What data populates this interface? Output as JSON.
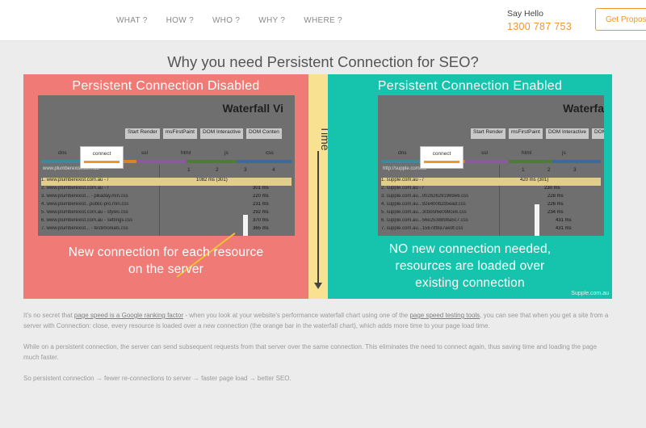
{
  "header": {
    "nav": [
      "WHAT ?",
      "HOW ?",
      "WHO ?",
      "WHY ?",
      "WHERE ?"
    ],
    "say_hello": "Say Hello",
    "phone": "1300 787 753",
    "cta": "Get Proposal"
  },
  "title": "Why you need Persistent Connection for SEO?",
  "infographic": {
    "left_heading": "Persistent Connection Disabled",
    "right_heading": "Persistent Connection Enabled",
    "time_label": "Time",
    "left_caption_1": "New connection for each resource",
    "left_caption_2": "on the server",
    "right_caption_1": "NO new connection needed,",
    "right_caption_2": "resources are loaded over",
    "right_caption_3": "existing connection",
    "credit": "Supple.com.au",
    "waterfall_title_left": "Waterfall Vi",
    "waterfall_title_right": "Waterfa",
    "legend_left": [
      "Start Render",
      "msFirstPaint",
      "DOM Interactive",
      "DOM Conten"
    ],
    "legend_right": [
      "Start Render",
      "msFirstPaint",
      "DOM Interactive",
      "DOM Co"
    ],
    "columns": [
      "dns",
      "connect",
      "ssl",
      "html",
      "js",
      "css"
    ],
    "connect_label": "connect",
    "axis": [
      "1",
      "2",
      "3",
      "4"
    ],
    "left_url": "www.plumberexist.com.au",
    "right_url": "http://supple.com.au",
    "left_rows": [
      "1. www.plumberexist.com.au - /",
      "2. www.plumberexist.com.au - /",
      "3. www.plumberexist... - pikaday.min.css",
      "4. www.plumberexist...public-pro.min.css",
      "5. www.plumberexist.com.au - styles.css",
      "6. www.plumberexist.com.au - settings.css",
      "7. www.plumberexist... - testimonials.css"
    ],
    "right_rows": [
      "1. supple.com.au - /",
      "2. supple.com.au - /",
      "3. supple.com.au...002626291969e6.css",
      "4. supple.com.au...92e400b2d5ead.css",
      "5. supple.com.au...3cbb5f6e098ce6.css",
      "6. supple.com.au...56e2538898a5c7.css",
      "7. supple.com.au...1567df8a7ae9f.css"
    ],
    "left_ms": [
      "1082 ms (301)",
      "301 ms",
      "220 ms",
      "231 ms",
      "292 ms",
      "370 ms",
      "365 ms"
    ],
    "right_ms": [
      "420 ms (301)",
      "230 ms",
      "228 ms",
      "226 ms",
      "234 ms",
      "431 ms",
      "431 ms"
    ]
  },
  "paragraphs": {
    "p1_a": "It's no secret that ",
    "p1_link1": "page speed is a Google ranking factor",
    "p1_b": " - when you look at your website's performance waterfall chart using one of the ",
    "p1_link2": "page speed testing tools",
    "p1_c": ", you can see that when you get a site from a server with Connection: close, every resource is loaded over a new connection (the orange bar in the waterfall chart), which adds more time to your page load time.",
    "p2": "While on a persistent connection, the server can send subsequent requests from that server over the same connection. This eliminates the need to connect again, thus saving time and loading the page much faster.",
    "p3": "So persistent connection → fewer re-connections to server → faster page load → better SEO."
  },
  "colors": {
    "accent": "#f0962d",
    "disabled_panel": "#ef7a76",
    "enabled_panel": "#16c4ad",
    "time_panel": "#f8e190"
  }
}
